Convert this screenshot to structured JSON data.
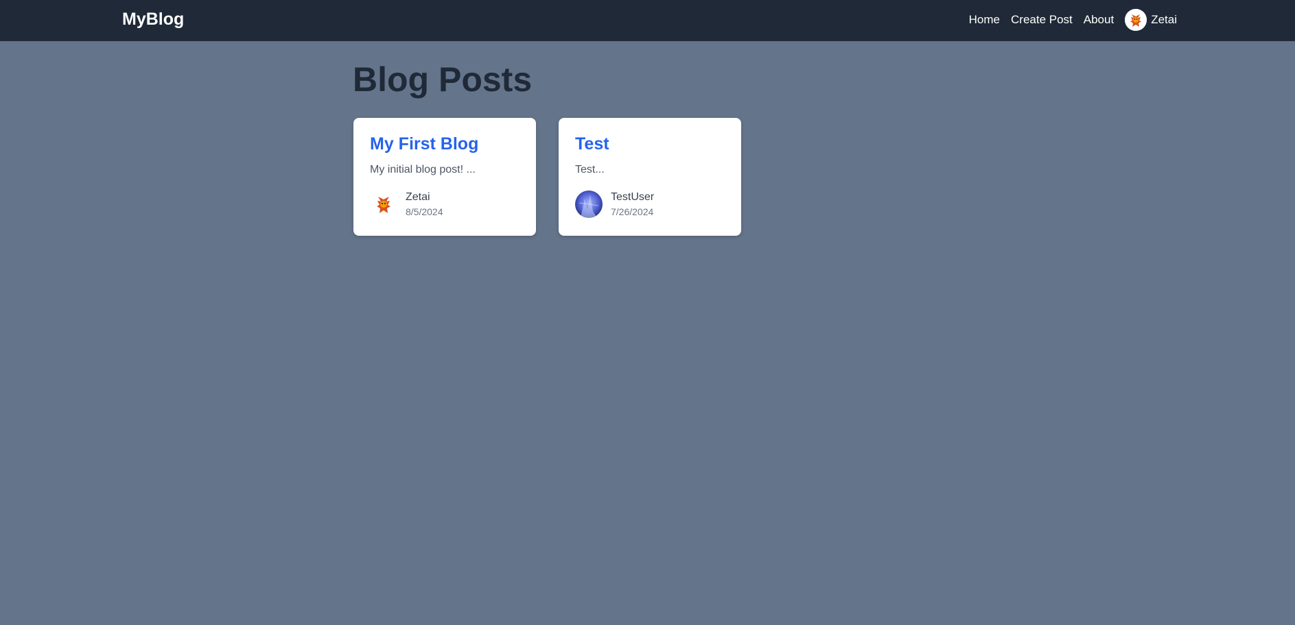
{
  "navbar": {
    "brand": "MyBlog",
    "links": [
      "Home",
      "Create Post",
      "About"
    ],
    "user": {
      "name": "Zetai"
    }
  },
  "page": {
    "title": "Blog Posts"
  },
  "posts": [
    {
      "title": "My First Blog",
      "excerpt": "My initial blog post! ...",
      "author": "Zetai",
      "date": "8/5/2024"
    },
    {
      "title": "Test",
      "excerpt": "Test...",
      "author": "TestUser",
      "date": "7/26/2024"
    }
  ],
  "colors": {
    "background": "#64748b",
    "navbar": "#1f2937",
    "title_link": "#2563eb"
  }
}
